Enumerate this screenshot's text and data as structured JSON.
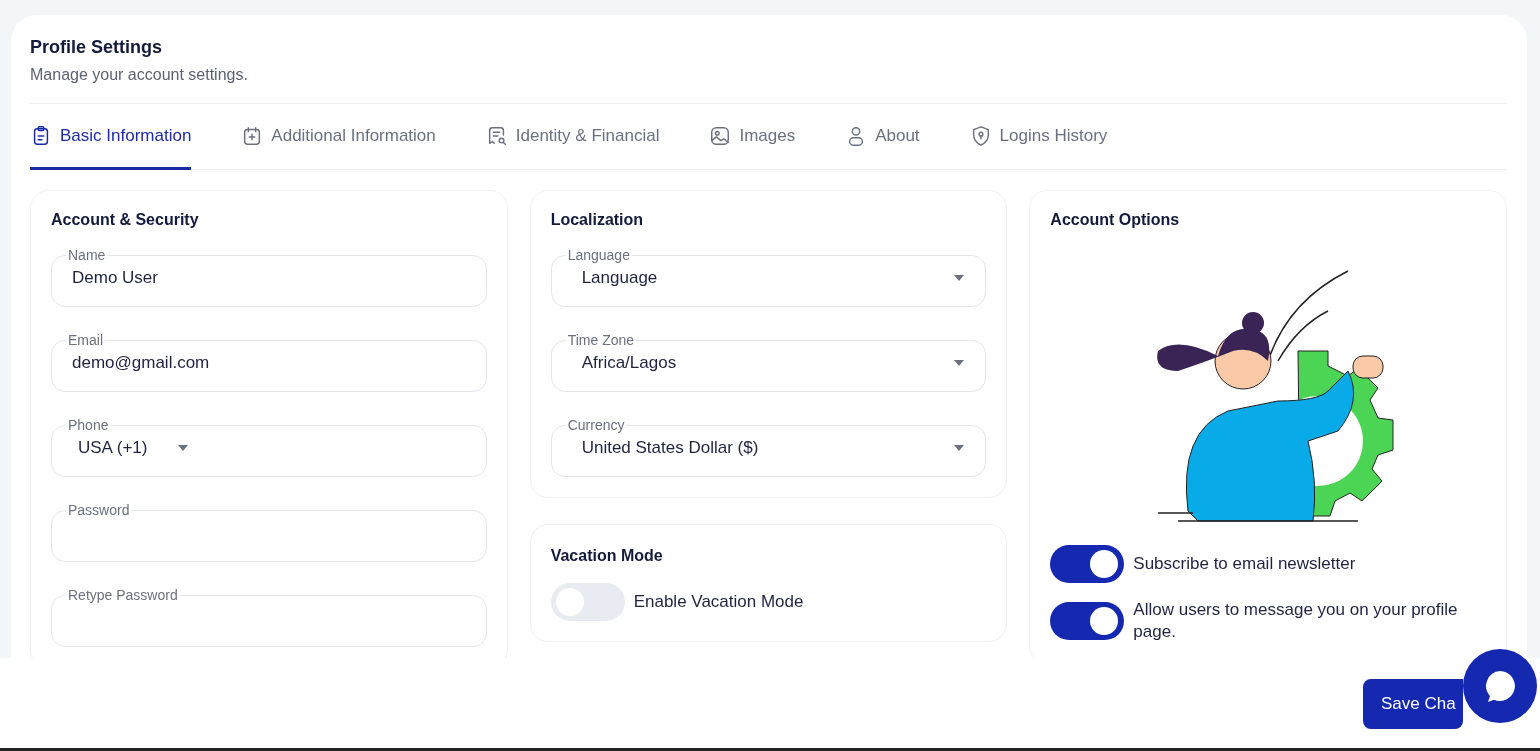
{
  "header": {
    "title": "Profile Settings",
    "subtitle": "Manage your account settings."
  },
  "tabs": [
    {
      "label": "Basic Information",
      "selected": true
    },
    {
      "label": "Additional Information",
      "selected": false
    },
    {
      "label": "Identity & Financial",
      "selected": false
    },
    {
      "label": "Images",
      "selected": false
    },
    {
      "label": "About",
      "selected": false
    },
    {
      "label": "Logins History",
      "selected": false
    }
  ],
  "account_security": {
    "title": "Account & Security",
    "fields": [
      {
        "kind": "text",
        "label": "Name",
        "value": "Demo User"
      },
      {
        "kind": "text",
        "label": "Email",
        "value": "demo@gmail.com"
      },
      {
        "kind": "phone",
        "label": "Phone",
        "value": "USA (+1)"
      },
      {
        "kind": "password",
        "label": "Password"
      },
      {
        "kind": "password",
        "label": "Retype Password"
      }
    ]
  },
  "localization": {
    "title": "Localization",
    "fields": [
      {
        "kind": "select",
        "label": "Language",
        "value": "Language"
      },
      {
        "kind": "select",
        "label": "Time Zone",
        "value": "Africa/Lagos"
      },
      {
        "kind": "select",
        "label": "Currency",
        "value": "United States Dollar ($)"
      }
    ]
  },
  "vacation_mode": {
    "title": "Vacation Mode",
    "toggles": [
      {
        "label": "Enable Vacation Mode",
        "on": false
      }
    ]
  },
  "account_options": {
    "title": "Account Options",
    "toggles": [
      {
        "label": "Subscribe to email newsletter",
        "on": true
      },
      {
        "label": "Allow users to message you on your profile page.",
        "on": true
      }
    ]
  },
  "footer": {
    "save_button": "Save Cha"
  }
}
